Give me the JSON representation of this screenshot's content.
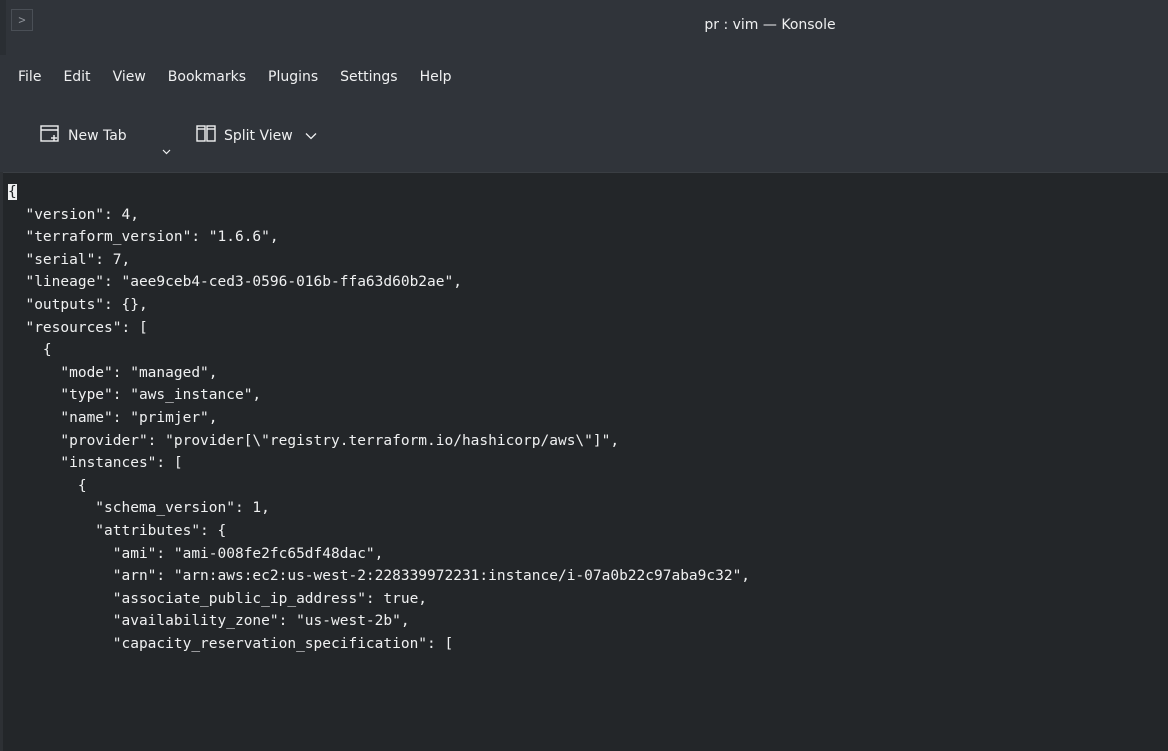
{
  "window": {
    "title": "pr : vim — Konsole",
    "app_icon_glyph": ">"
  },
  "menubar": {
    "items": [
      "File",
      "Edit",
      "View",
      "Bookmarks",
      "Plugins",
      "Settings",
      "Help"
    ]
  },
  "toolbar": {
    "new_tab_label": "New Tab",
    "split_view_label": "Split View",
    "new_tab_icon": "new-tab-icon",
    "split_view_icon": "split-view-icon",
    "chevron_glyph": "⌄"
  },
  "terminal": {
    "cursor_char": "{",
    "lines": [
      "",
      "  \"version\": 4,",
      "  \"terraform_version\": \"1.6.6\",",
      "  \"serial\": 7,",
      "  \"lineage\": \"aee9ceb4-ced3-0596-016b-ffa63d60b2ae\",",
      "  \"outputs\": {},",
      "  \"resources\": [",
      "    {",
      "      \"mode\": \"managed\",",
      "      \"type\": \"aws_instance\",",
      "      \"name\": \"primjer\",",
      "      \"provider\": \"provider[\\\"registry.terraform.io/hashicorp/aws\\\"]\",",
      "      \"instances\": [",
      "        {",
      "          \"schema_version\": 1,",
      "          \"attributes\": {",
      "            \"ami\": \"ami-008fe2fc65df48dac\",",
      "            \"arn\": \"arn:aws:ec2:us-west-2:228339972231:instance/i-07a0b22c97aba9c32\",",
      "            \"associate_public_ip_address\": true,",
      "            \"availability_zone\": \"us-west-2b\",",
      "            \"capacity_reservation_specification\": ["
    ]
  },
  "colors": {
    "chrome_bg": "#30343a",
    "terminal_bg": "#232629",
    "text": "#eff0f1"
  }
}
